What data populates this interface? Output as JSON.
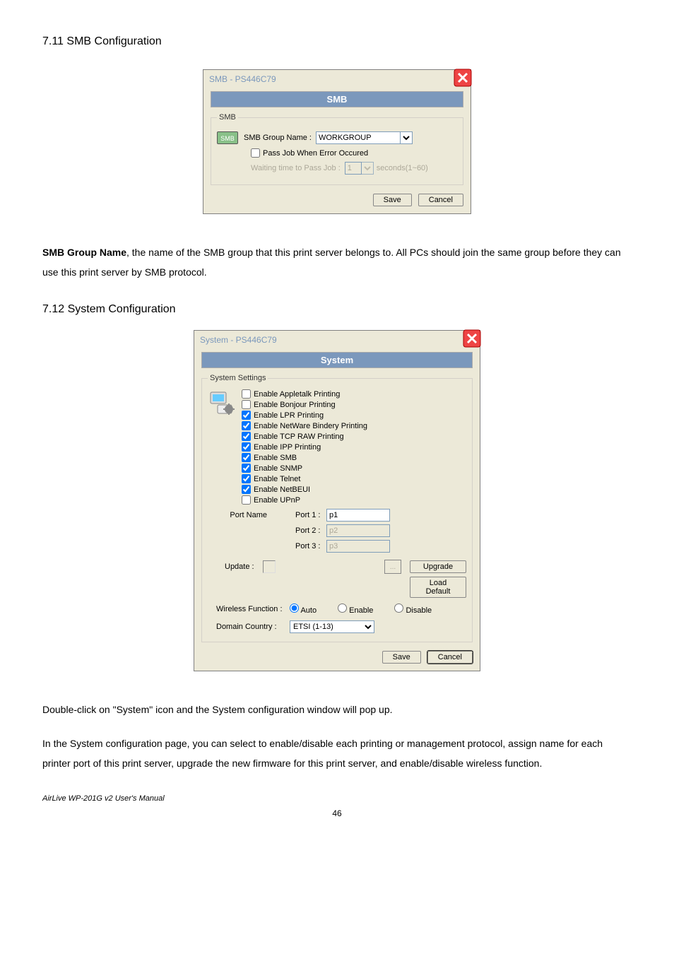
{
  "doc": {
    "heading_711": "7.11 SMB Configuration",
    "heading_712": "7.12 System Configuration",
    "smb_paragraph_pre": "SMB Group Name",
    "smb_paragraph_post": ", the name of the SMB group that this print server belongs to. All PCs should join the same group before they can use this print server by SMB protocol.",
    "sys_p1": "Double-click on \"System\" icon and the System configuration window will pop up.",
    "sys_p2": "In the System configuration page, you can select to enable/disable each printing or management protocol, assign name for each printer port of this print server, upgrade the new firmware for this print server, and enable/disable wireless function.",
    "footer": "AirLive WP-201G v2 User's Manual",
    "page_num": "46"
  },
  "smb_dialog": {
    "title": "SMB - PS446C79",
    "banner": "SMB",
    "legend": "SMB",
    "icon_text": "SMB",
    "group_label": "SMB Group Name :",
    "group_value": "WORKGROUP",
    "pass_label": "Pass Job When Error Occured",
    "wait_label": "Waiting time to Pass Job :",
    "wait_value": "1",
    "wait_suffix": "seconds(1~60)",
    "save": "Save",
    "cancel": "Cancel"
  },
  "sys_dialog": {
    "title": "System - PS446C79",
    "banner": "System",
    "legend": "System Settings",
    "opts": {
      "appletalk": "Enable Appletalk Printing",
      "bonjour": "Enable Bonjour Printing",
      "lpr": "Enable LPR Printing",
      "netware": "Enable NetWare Bindery Printing",
      "tcpraw": "Enable TCP RAW Printing",
      "ipp": "Enable IPP Printing",
      "smb": "Enable SMB",
      "snmp": "Enable SNMP",
      "telnet": "Enable Telnet",
      "netbeui": "Enable NetBEUI",
      "upnp": "Enable UPnP"
    },
    "portname_label": "Port Name",
    "port1_label": "Port 1 :",
    "port1_value": "p1",
    "port2_label": "Port 2 :",
    "port2_value": "p2",
    "port3_label": "Port 3 :",
    "port3_value": "p3",
    "update_label": "Update :",
    "dots": "...",
    "upgrade": "Upgrade",
    "load_default": "Load Default",
    "wireless_label": "Wireless Function :",
    "auto": "Auto",
    "enable": "Enable",
    "disable": "Disable",
    "domain_label": "Domain Country :",
    "domain_value": "ETSI (1-13)",
    "save": "Save",
    "cancel": "Cancel"
  }
}
